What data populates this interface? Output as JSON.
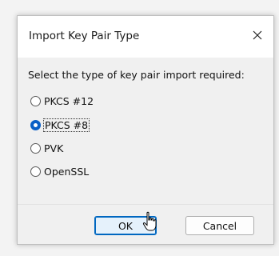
{
  "dialog": {
    "title": "Import Key Pair Type",
    "prompt": "Select the type of key pair import required:",
    "options": [
      {
        "label": "PKCS #12",
        "checked": false
      },
      {
        "label": "PKCS #8",
        "checked": true
      },
      {
        "label": "PVK",
        "checked": false
      },
      {
        "label": "OpenSSL",
        "checked": false
      }
    ],
    "ok_label": "OK",
    "cancel_label": "Cancel",
    "close_icon": "close-icon"
  },
  "colors": {
    "accent": "#0a5fc6",
    "dialog_bg": "#f0f0f0"
  }
}
